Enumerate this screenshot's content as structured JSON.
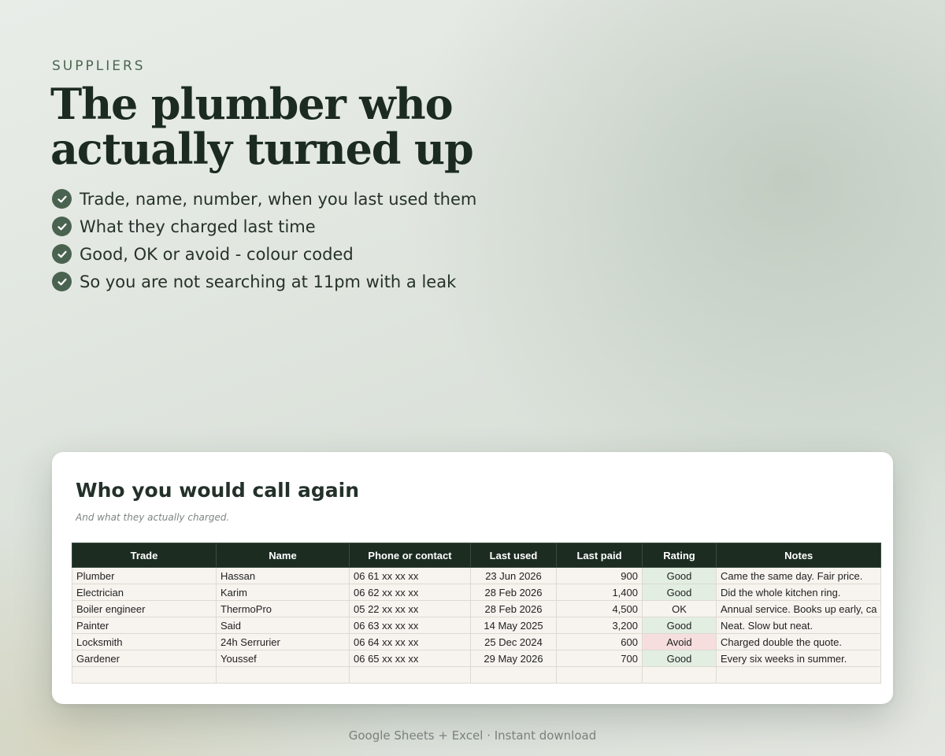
{
  "hero": {
    "eyebrow": "SUPPLIERS",
    "headline_line1": "The plumber who",
    "headline_line2": "actually turned up",
    "features": [
      "Trade, name, number, when you last used them",
      "What they charged last time",
      "Good, OK or avoid - colour coded",
      "So you are not searching at 11pm with a leak"
    ],
    "check_icon": "check-circle-icon"
  },
  "card": {
    "title": "Who you would call again",
    "subtitle": "And what they actually charged."
  },
  "table": {
    "columns": [
      "Trade",
      "Name",
      "Phone or contact",
      "Last used",
      "Last paid",
      "Rating",
      "Notes"
    ],
    "rows": [
      {
        "trade": "Plumber",
        "name": "Hassan",
        "phone": "06 61 xx xx xx",
        "last_used": "23 Jun 2026",
        "last_paid": "900",
        "rating": "Good",
        "notes": "Came the same day. Fair price."
      },
      {
        "trade": "Electrician",
        "name": "Karim",
        "phone": "06 62 xx xx xx",
        "last_used": "28 Feb 2026",
        "last_paid": "1,400",
        "rating": "Good",
        "notes": "Did the whole kitchen ring."
      },
      {
        "trade": "Boiler engineer",
        "name": "ThermoPro",
        "phone": "05 22 xx xx xx",
        "last_used": "28 Feb 2026",
        "last_paid": "4,500",
        "rating": "OK",
        "notes": "Annual service. Books up early, ca"
      },
      {
        "trade": "Painter",
        "name": "Said",
        "phone": "06 63 xx xx xx",
        "last_used": "14 May 2025",
        "last_paid": "3,200",
        "rating": "Good",
        "notes": "Neat. Slow but neat."
      },
      {
        "trade": "Locksmith",
        "name": "24h Serrurier",
        "phone": "06 64 xx xx xx",
        "last_used": "25 Dec 2024",
        "last_paid": "600",
        "rating": "Avoid",
        "notes": "Charged double the quote."
      },
      {
        "trade": "Gardener",
        "name": "Youssef",
        "phone": "06 65 xx xx xx",
        "last_used": "29 May 2026",
        "last_paid": "700",
        "rating": "Good",
        "notes": "Every six weeks in summer."
      },
      {
        "trade": "",
        "name": "",
        "phone": "",
        "last_used": "",
        "last_paid": "",
        "rating": "",
        "notes": ""
      }
    ],
    "rating_colors": {
      "Good": "#e2eee2",
      "OK": "#f7f4ef",
      "Avoid": "#f6dede"
    }
  },
  "footer": {
    "text": "Google Sheets + Excel  ·  Instant download"
  },
  "colors": {
    "header_bg": "#1c2c21",
    "accent": "#4a6350",
    "headline": "#1c2b22"
  }
}
